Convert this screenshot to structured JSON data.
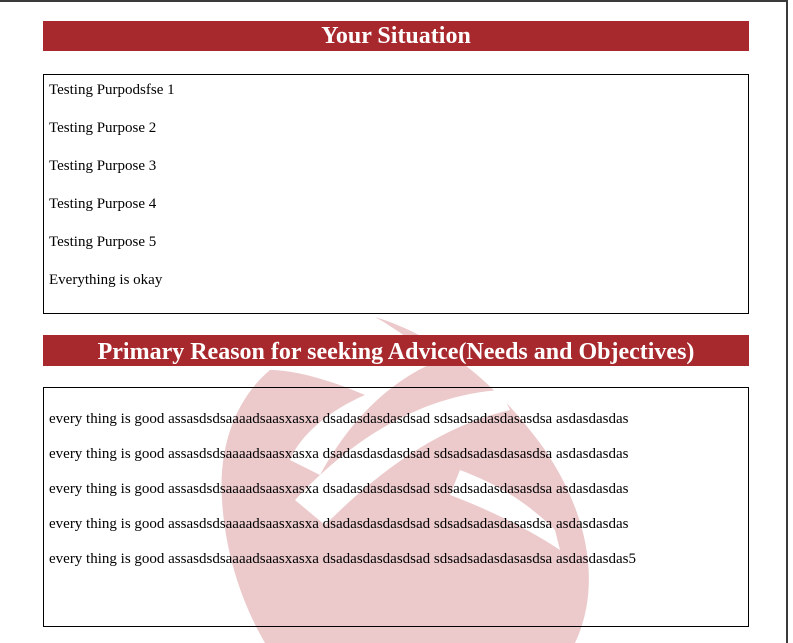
{
  "situation": {
    "title": "Your Situation",
    "items": [
      "Testing Purpodsfse 1",
      "Testing Purpose 2",
      "Testing Purpose 3",
      "Testing Purpose 4",
      "Testing Purpose 5",
      "Everything is okay"
    ]
  },
  "reason": {
    "title": "Primary Reason for seeking Advice(Needs and Objectives)",
    "lines": [
      "every thing is good assasdsdsaaaadsaasxasxa dsadasdasdasdsad sdsadsadasdasasdsa asdasdasdas",
      "every thing is good assasdsdsaaaadsaasxasxa dsadasdasdasdsad sdsadsadasdasasdsa asdasdasdas",
      "every thing is good assasdsdsaaaadsaasxasxa dsadasdasdasdsad sdsadsadasdasasdsa asdasdasdas",
      "every thing is good assasdsdsaaaadsaasxasxa dsadasdasdasdsad sdsadsadasdasasdsa asdasdasdas",
      "every thing is good assasdsdsaaaadsaasxasxa dsadasdasdasdsad sdsadsadasdasasdsa asdasdasdas5"
    ]
  },
  "colors": {
    "header_bg": "#a8292d",
    "header_text": "#ffffff",
    "watermark": "#eccacc"
  },
  "watermark_icon": "tulip-logo-watermark"
}
